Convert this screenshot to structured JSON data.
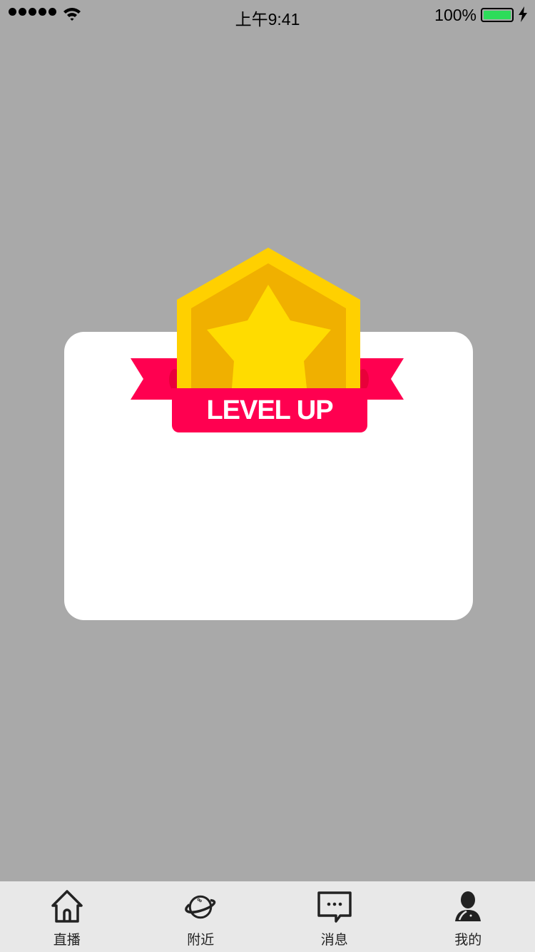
{
  "status_bar": {
    "time": "上午9:41",
    "battery": "100%"
  },
  "dialog": {
    "badge_text": "LEVEL UP"
  },
  "tabbar": {
    "items": [
      {
        "label": "直播",
        "icon": "home-icon"
      },
      {
        "label": "附近",
        "icon": "planet-icon"
      },
      {
        "label": "消息",
        "icon": "message-icon"
      },
      {
        "label": "我的",
        "icon": "user-icon"
      }
    ]
  },
  "colors": {
    "ribbon": "#ff0050",
    "badge_outer": "#ffd000",
    "badge_inner": "#f0b000",
    "star": "#ffdc00",
    "battery": "#2ddc5a"
  }
}
